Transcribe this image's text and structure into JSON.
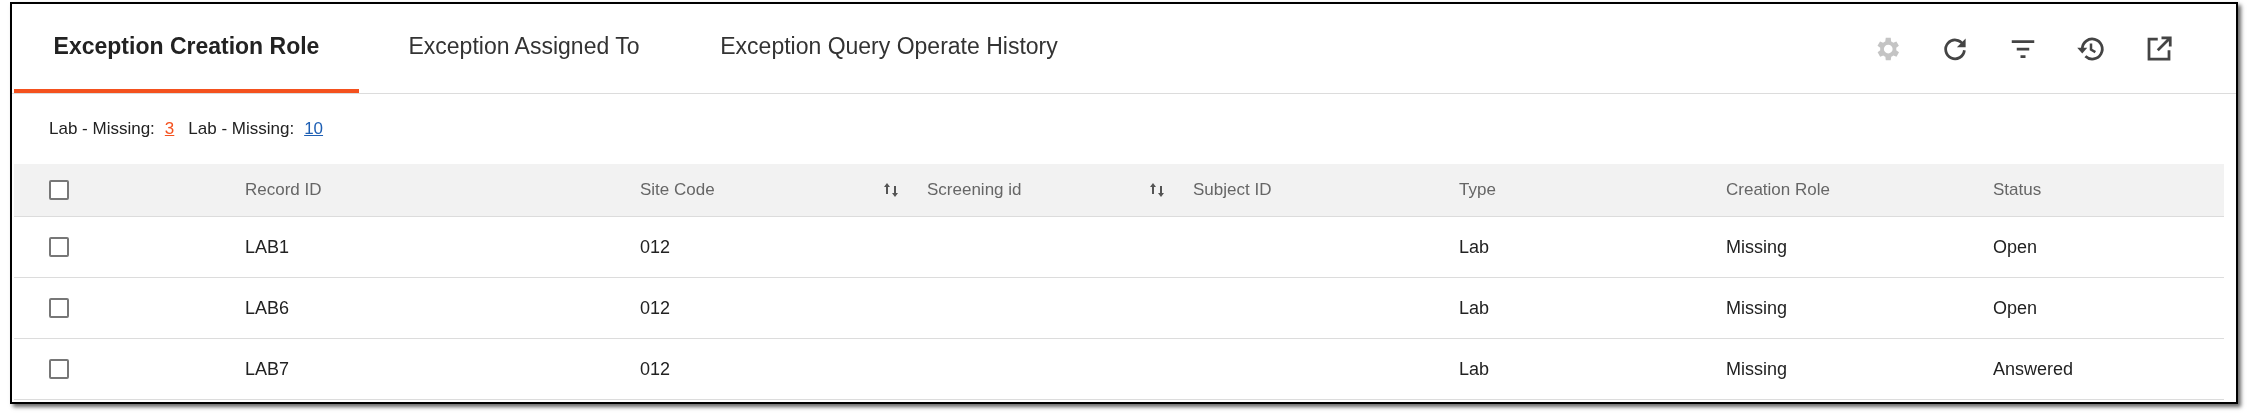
{
  "tabs": [
    {
      "label": "Exception Creation Role",
      "selected": true
    },
    {
      "label": "Exception Assigned To",
      "selected": false
    },
    {
      "label": "Exception Query Operate History",
      "selected": false
    }
  ],
  "toolbar": [
    {
      "kind": "settings",
      "disabled": true
    },
    {
      "kind": "refresh",
      "disabled": false
    },
    {
      "kind": "filter",
      "disabled": false
    },
    {
      "kind": "history",
      "disabled": false
    },
    {
      "kind": "open_external",
      "disabled": false
    }
  ],
  "summary": [
    {
      "label": "Lab - Missing:",
      "count": "3",
      "color": "#f4511e"
    },
    {
      "label": "Lab - Missing:",
      "count": "10",
      "color": "#1e5fb4"
    }
  ],
  "table": {
    "header_checked": false,
    "columns": [
      {
        "label": "Record ID",
        "sortable": false
      },
      {
        "label": "Site Code",
        "sortable": true
      },
      {
        "label": "Screening id",
        "sortable": true
      },
      {
        "label": "Subject ID",
        "sortable": false
      },
      {
        "label": "Type",
        "sortable": false
      },
      {
        "label": "Creation Role",
        "sortable": false
      },
      {
        "label": "Status",
        "sortable": false
      }
    ],
    "rows": [
      {
        "checked": false,
        "cells": [
          "LAB1",
          "012",
          null,
          null,
          "Lab",
          "Missing",
          "Open"
        ]
      },
      {
        "checked": false,
        "cells": [
          "LAB6",
          "012",
          null,
          null,
          "Lab",
          "Missing",
          "Open"
        ]
      },
      {
        "checked": false,
        "cells": [
          "LAB7",
          "012",
          null,
          null,
          "Lab",
          "Missing",
          "Answered"
        ]
      }
    ]
  }
}
